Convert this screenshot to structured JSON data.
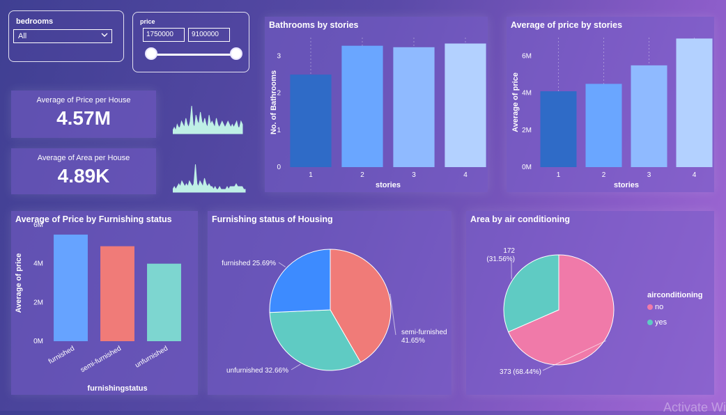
{
  "filters": {
    "bedrooms": {
      "title": "bedrooms",
      "value": "All"
    },
    "price": {
      "title": "price",
      "min": "1750000",
      "max": "9100000"
    }
  },
  "kpis": [
    {
      "label": "Average of Price per House",
      "value": "4.57M"
    },
    {
      "label": "Average of Area per House",
      "value": "4.89K"
    }
  ],
  "sparklines": {
    "price": [
      1,
      2,
      1,
      3,
      2,
      2,
      4,
      3,
      2,
      5,
      3,
      2,
      4,
      9,
      3,
      2,
      6,
      4,
      3,
      7,
      4,
      3,
      5,
      3,
      2,
      6,
      3,
      4,
      3,
      2,
      5,
      3,
      2,
      3,
      4,
      3,
      2,
      3,
      4,
      3,
      2,
      3,
      2,
      3,
      4,
      2,
      2,
      4,
      3
    ],
    "area": [
      1,
      2,
      1,
      2,
      3,
      2,
      4,
      3,
      2,
      3,
      2,
      4,
      3,
      2,
      3,
      10,
      3,
      2,
      4,
      3,
      2,
      5,
      3,
      2,
      3,
      2,
      2,
      1,
      2,
      1,
      1,
      2,
      1,
      1,
      1,
      1,
      2,
      1,
      2,
      2,
      2,
      2,
      3,
      2,
      2,
      2,
      2,
      1,
      1
    ]
  },
  "chart_data": [
    {
      "type": "bar",
      "title": "Bathrooms by stories",
      "categories": [
        "1",
        "2",
        "3",
        "4"
      ],
      "values": [
        2.5,
        3.28,
        3.24,
        3.34
      ],
      "xlabel": "stories",
      "ylabel": "No. of Bathrooms",
      "ylim": [
        0,
        3.5
      ],
      "yticks": [
        0,
        1,
        2,
        3
      ],
      "yticklabels": [
        "0",
        "1",
        "2",
        "3"
      ],
      "colors": [
        "#2f6bc7",
        "#6aa6ff",
        "#8fbaff",
        "#b3d1ff"
      ],
      "grid": true
    },
    {
      "type": "bar",
      "title": "Average of price by stories",
      "categories": [
        "1",
        "2",
        "3",
        "4"
      ],
      "values": [
        4.1,
        4.5,
        5.5,
        6.95
      ],
      "xlabel": "stories",
      "ylabel": "Average of price",
      "ylim": [
        0,
        7
      ],
      "yticks": [
        0,
        2,
        4,
        6
      ],
      "yticklabels": [
        "0M",
        "2M",
        "4M",
        "6M"
      ],
      "colors": [
        "#2f6bc7",
        "#6aa6ff",
        "#8fbaff",
        "#b3d1ff"
      ],
      "grid": true
    },
    {
      "type": "bar",
      "title": "Average of Price by Furnishing status",
      "categories": [
        "furnished",
        "semi-furnished",
        "unfurnished"
      ],
      "values": [
        5.5,
        4.9,
        4.0
      ],
      "xlabel": "furnishingstatus",
      "ylabel": "Average of price",
      "ylim": [
        0,
        6
      ],
      "yticks": [
        0,
        2,
        4,
        6
      ],
      "yticklabels": [
        "0M",
        "2M",
        "4M",
        "6M"
      ],
      "colors": [
        "#66a3ff",
        "#f07b78",
        "#7dd6d0"
      ],
      "grid": false
    },
    {
      "type": "pie",
      "title": "Furnishing status of Housing",
      "slices": [
        {
          "label": "semi-furnished",
          "display": "semi-furnished 41.65%",
          "value": 41.65,
          "color": "#f07b78"
        },
        {
          "label": "unfurnished",
          "display": "unfurnished 32.66%",
          "value": 32.66,
          "color": "#5fcbc3"
        },
        {
          "label": "furnished",
          "display": "furnished 25.69%",
          "value": 25.69,
          "color": "#3d8bff"
        }
      ]
    },
    {
      "type": "pie",
      "title": "Area by air conditioning",
      "legend_title": "airconditioning",
      "legend_position": "right",
      "slices": [
        {
          "label": "no",
          "display": "373 (68.44%)",
          "value": 373,
          "percent": 68.44,
          "color": "#f07aa9"
        },
        {
          "label": "yes",
          "display": "172 (31.56%)",
          "value": 172,
          "percent": 31.56,
          "color": "#5fcbc3"
        }
      ]
    }
  ],
  "watermark": "Activate Wi"
}
